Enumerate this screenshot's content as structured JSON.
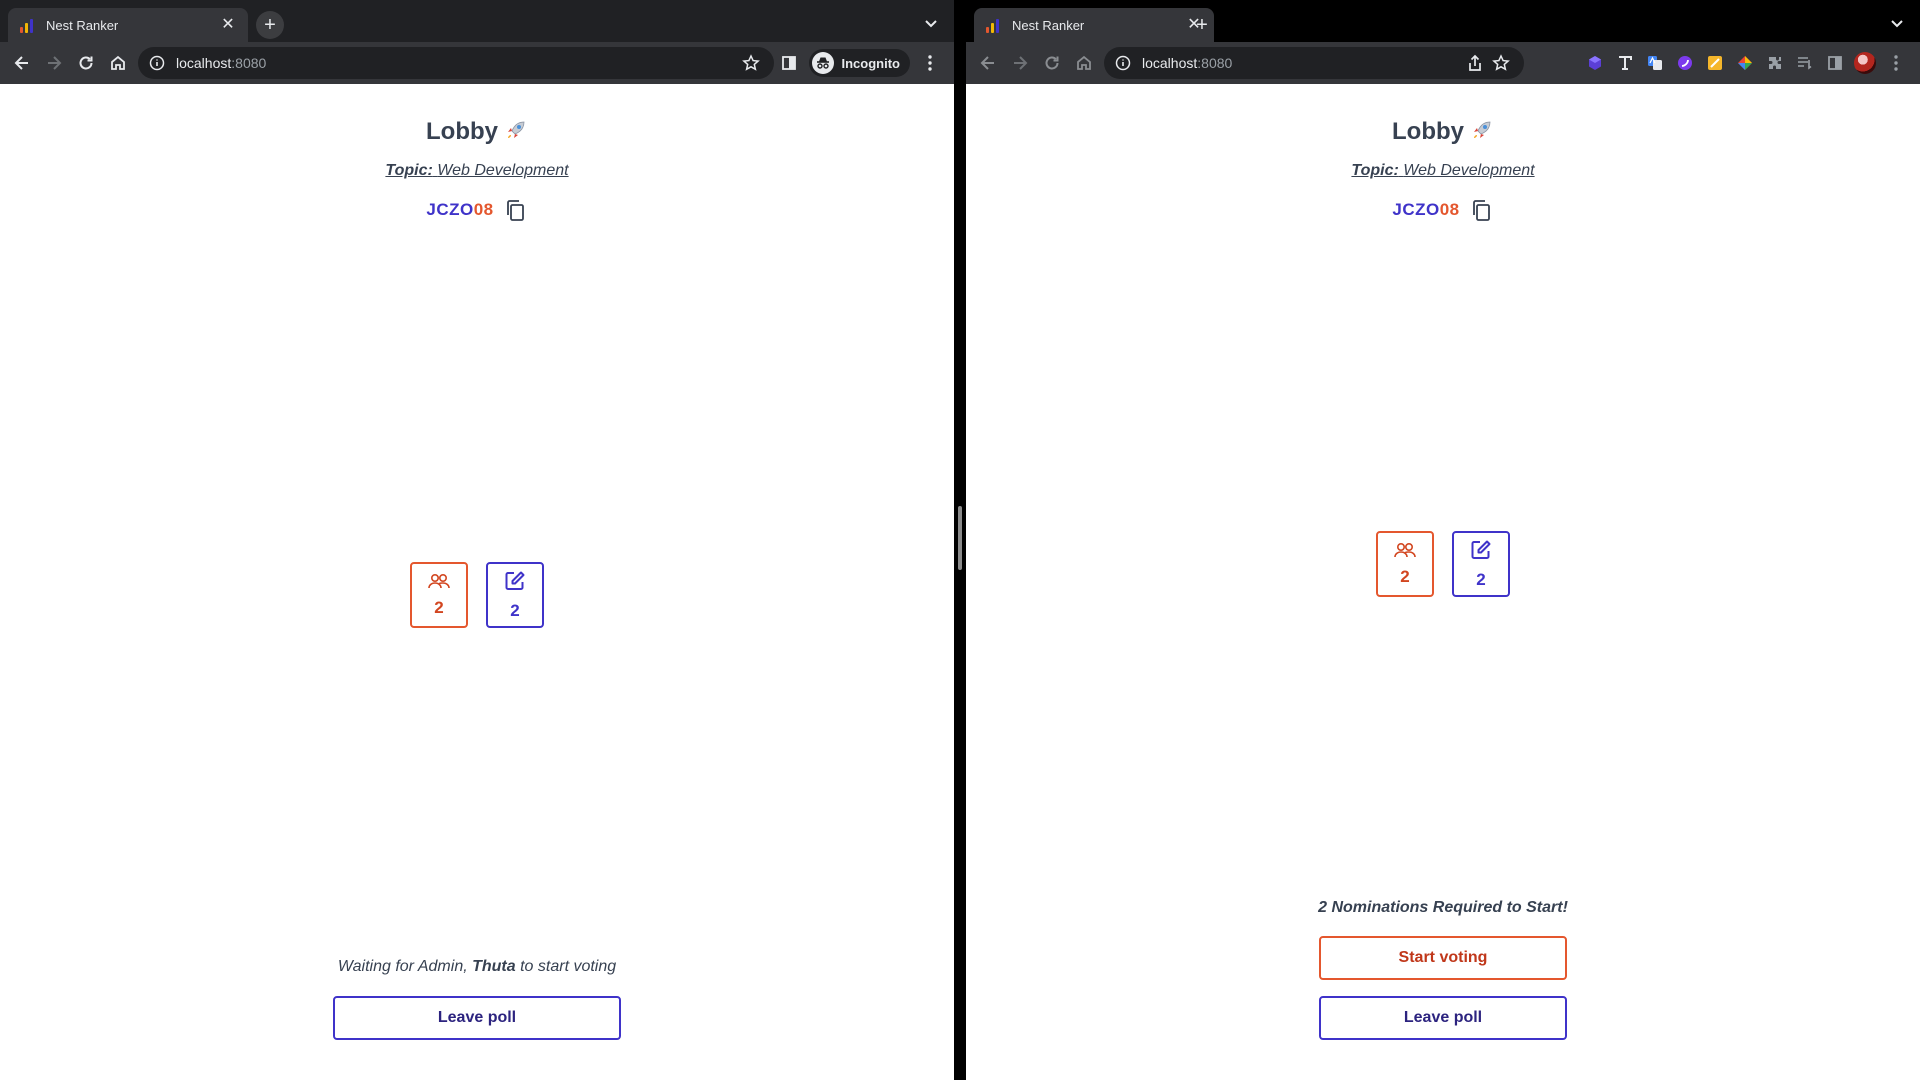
{
  "left_window": {
    "mode": "incognito",
    "tab": {
      "title": "Nest Ranker"
    },
    "address": {
      "host": "localhost",
      "port": ":8080"
    },
    "incognito_label": "Incognito",
    "page": {
      "title": "Lobby",
      "title_icon": "rocket-icon",
      "topic_key": "Topic:",
      "topic_value": "Web Development",
      "poll_id_part1": "JCZO",
      "poll_id_part2": "08",
      "participants_count": "2",
      "nominations_count": "2",
      "waiting_prefix": "Waiting for Admin, ",
      "admin_name": "Thuta",
      "waiting_suffix": " to start voting",
      "leave_label": "Leave poll"
    }
  },
  "right_window": {
    "mode": "normal",
    "tab": {
      "title": "Nest Ranker"
    },
    "address": {
      "host": "localhost",
      "port": ":8080"
    },
    "extensions": [
      "cube-extension-icon",
      "font-extension-icon",
      "translate-extension-icon",
      "circle-extension-icon",
      "notes-extension-icon",
      "color-extension-icon",
      "puzzle-icon",
      "reading-list-icon",
      "side-panel-icon",
      "profile-avatar"
    ],
    "page": {
      "title": "Lobby",
      "title_icon": "rocket-icon",
      "topic_key": "Topic:",
      "topic_value": "Web Development",
      "poll_id_part1": "JCZO",
      "poll_id_part2": "08",
      "participants_count": "2",
      "nominations_count": "2",
      "requirement_text": "2 Nominations Required to Start!",
      "start_label": "Start voting",
      "leave_label": "Leave poll"
    }
  },
  "colors": {
    "purple": "#3f33c9",
    "orange": "#e4572e",
    "text": "#374151"
  }
}
